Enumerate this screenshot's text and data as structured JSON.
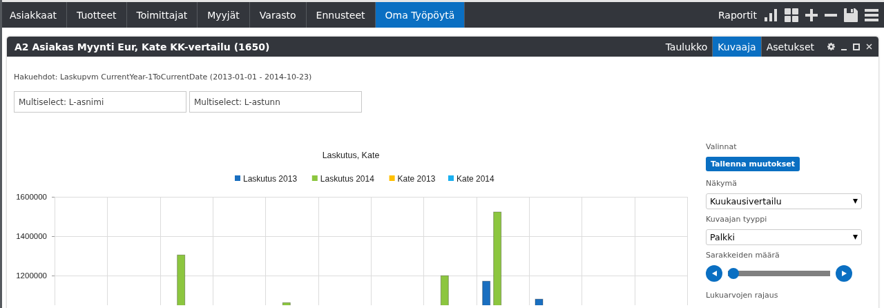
{
  "nav": {
    "tabs": [
      {
        "label": "Asiakkaat",
        "selected": false
      },
      {
        "label": "Tuotteet",
        "selected": false
      },
      {
        "label": "Toimittajat",
        "selected": false
      },
      {
        "label": "Myyjät",
        "selected": false
      },
      {
        "label": "Varasto",
        "selected": false
      },
      {
        "label": "Ennusteet",
        "selected": false
      },
      {
        "label": "Oma Työpöytä",
        "selected": true
      }
    ],
    "reports_label": "Raportit"
  },
  "panel": {
    "title": "A2 Asiakas Myynti Eur, Kate KK-vertailu (1650)",
    "view_tabs": [
      {
        "label": "Taulukko",
        "selected": false
      },
      {
        "label": "Kuvaaja",
        "selected": true
      },
      {
        "label": "Asetukset",
        "selected": false
      }
    ],
    "criteria": "Hakuehdot: Laskupvm CurrentYear-1ToCurrentDate (2013-01-01 - 2014-10-23)",
    "filters": [
      {
        "placeholder": "Multiselect: L-asnimi"
      },
      {
        "placeholder": "Multiselect: L-astunn"
      }
    ],
    "chart": {
      "chart_data": {
        "type": "bar",
        "title": "Laskutus, Kate",
        "legend": true,
        "ylim": [
          1050000,
          1600000
        ],
        "yticks": [
          1200000,
          1400000,
          1600000
        ],
        "series": [
          {
            "name": "Laskutus 2013",
            "color": "#1a6fc0",
            "values": [
              null,
              null,
              null,
              null,
              null,
              null,
              null,
              null,
              1172000,
              1081000,
              null,
              null
            ]
          },
          {
            "name": "Laskutus 2014",
            "color": "#8cc63f",
            "values": [
              null,
              null,
              1305000,
              null,
              1063000,
              null,
              null,
              1200000,
              1523000,
              null,
              null,
              null
            ]
          },
          {
            "name": "Kate 2013",
            "color": "#ffc000",
            "values": [
              null,
              null,
              null,
              null,
              null,
              null,
              null,
              null,
              null,
              null,
              null,
              null
            ]
          },
          {
            "name": "Kate 2014",
            "color": "#1ab0f0",
            "values": [
              null,
              null,
              null,
              null,
              null,
              null,
              null,
              null,
              null,
              null,
              null,
              null
            ]
          }
        ]
      }
    },
    "options": {
      "heading": "Valinnat",
      "save_button": "Tallenna muutokset",
      "fields": [
        {
          "kind": "select",
          "label": "Näkymä",
          "value": "Kuukausivertailu"
        },
        {
          "kind": "select",
          "label": "Kuvaajan tyyppi",
          "value": "Palkki"
        },
        {
          "kind": "slider",
          "label": "Sarakkeiden määrä",
          "level": 0
        },
        {
          "kind": "heading",
          "label": "Lukuarvojen rajaus"
        }
      ]
    }
  }
}
